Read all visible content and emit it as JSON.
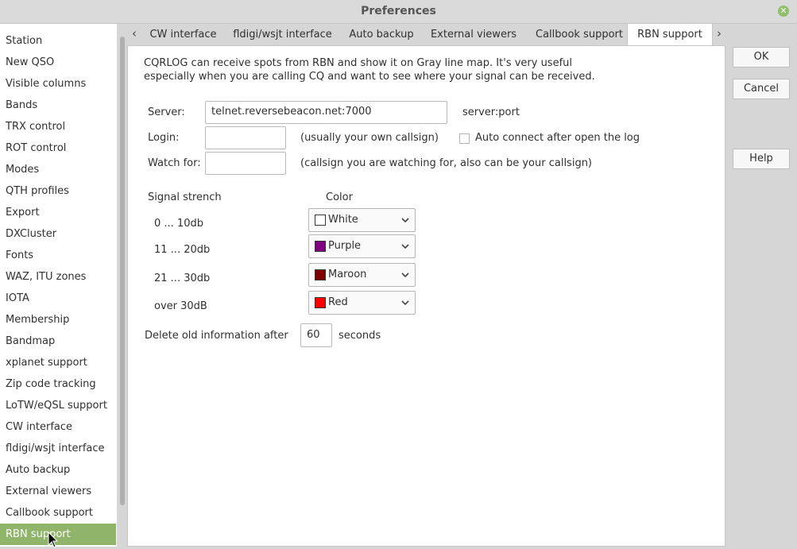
{
  "window": {
    "title": "Preferences",
    "close_icon": "close-icon"
  },
  "sidebar": {
    "items": [
      {
        "label": "Station"
      },
      {
        "label": "New QSO"
      },
      {
        "label": "Visible columns"
      },
      {
        "label": "Bands"
      },
      {
        "label": "TRX control"
      },
      {
        "label": "ROT control"
      },
      {
        "label": "Modes"
      },
      {
        "label": "QTH profiles"
      },
      {
        "label": "Export"
      },
      {
        "label": "DXCluster"
      },
      {
        "label": "Fonts"
      },
      {
        "label": "WAZ, ITU zones"
      },
      {
        "label": "IOTA"
      },
      {
        "label": "Membership"
      },
      {
        "label": "Bandmap"
      },
      {
        "label": "xplanet support"
      },
      {
        "label": "Zip code tracking"
      },
      {
        "label": "LoTW/eQSL support"
      },
      {
        "label": "CW interface"
      },
      {
        "label": "fldigi/wsjt interface"
      },
      {
        "label": "Auto backup"
      },
      {
        "label": "External viewers"
      },
      {
        "label": "Callbook support"
      },
      {
        "label": "RBN support"
      }
    ],
    "selected": "RBN support"
  },
  "tabs": {
    "items": [
      {
        "label": "CW interface"
      },
      {
        "label": "fldigi/wsjt interface"
      },
      {
        "label": "Auto backup"
      },
      {
        "label": "External viewers"
      },
      {
        "label": "Callbook support"
      },
      {
        "label": "RBN support"
      }
    ],
    "active": "RBN support"
  },
  "rbn": {
    "description_line1": "CQRLOG can receive spots from RBN and show it on Gray line map. It's very useful",
    "description_line2": "especially when you are calling CQ and want to see where your signal can be received.",
    "server_label": "Server:",
    "server_value": "telnet.reversebeacon.net:7000",
    "server_hint": "server:port",
    "login_label": "Login:",
    "login_value": "",
    "login_hint": "(usually your own callsign)",
    "auto_connect_label": "Auto connect after open the log",
    "auto_connect_checked": false,
    "watch_label": "Watch for:",
    "watch_value": "",
    "watch_hint": "(callsign you are watching for, also can be your callsign)",
    "signal_header": "Signal strench",
    "color_header": "Color",
    "signals": [
      {
        "label": "0 ... 10db",
        "color_name": "White",
        "color": "#ffffff"
      },
      {
        "label": "11 ... 20db",
        "color_name": "Purple",
        "color": "#800080"
      },
      {
        "label": "21 ... 30db",
        "color_name": "Maroon",
        "color": "#800000"
      },
      {
        "label": "over 30dB",
        "color_name": "Red",
        "color": "#ff0000"
      }
    ],
    "delete_label": "Delete old information after",
    "delete_value": "60",
    "delete_unit": "seconds"
  },
  "buttons": {
    "ok": "OK",
    "cancel": "Cancel",
    "help": "Help"
  },
  "colors": {
    "selection": "#8fb46a",
    "close": "#8fbf6b"
  }
}
